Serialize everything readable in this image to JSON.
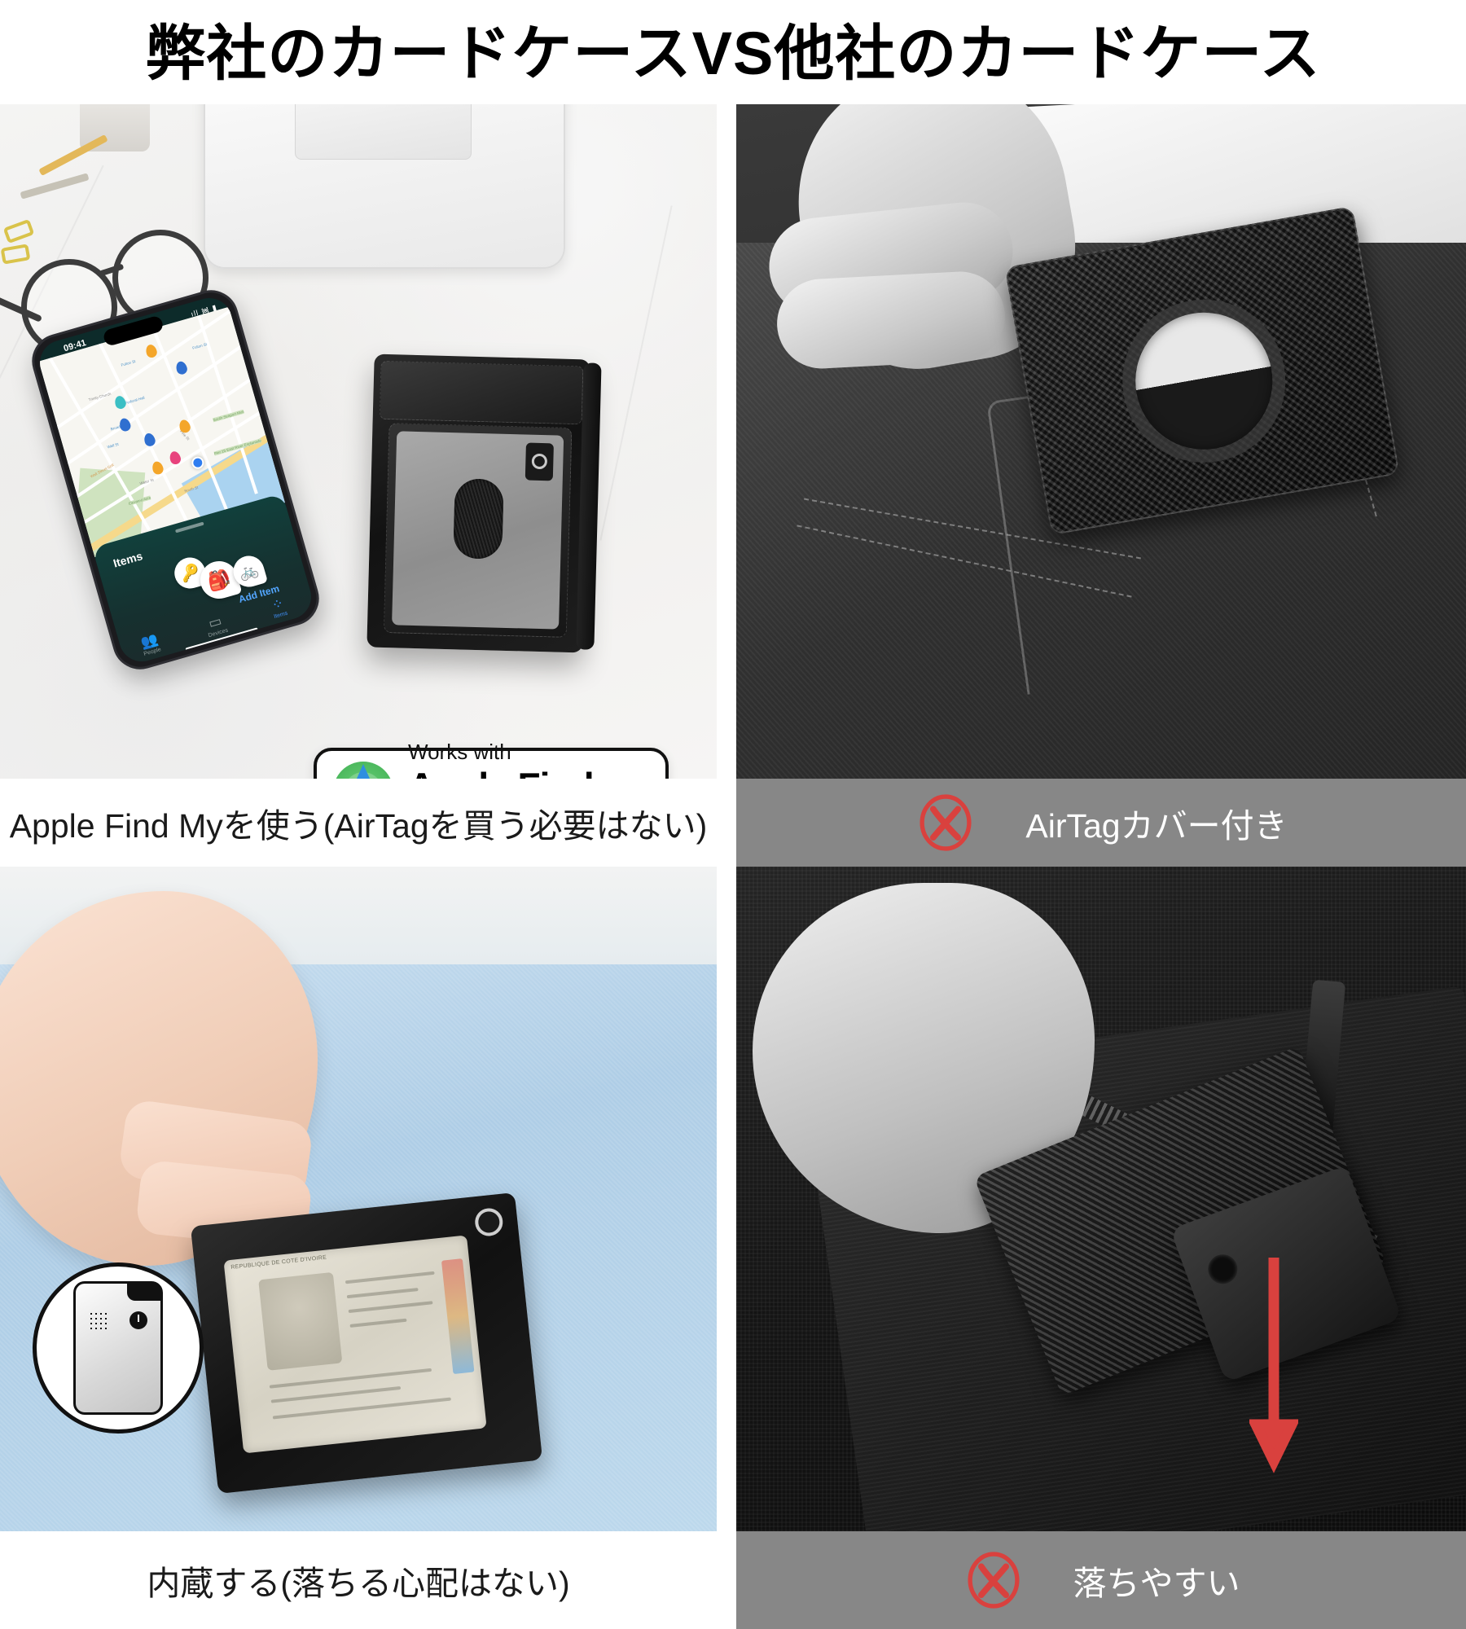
{
  "title": "弊社のカードケースVS他社のカードケース",
  "panels": {
    "top_left": {
      "caption": "Apple Find Myを使う(AirTagを買う必要はない)",
      "badge": {
        "small_text": "Works with",
        "big_text": "Apple Find My",
        "icon": "find-my-radar-icon"
      },
      "phone": {
        "status_time": "09:41",
        "status_right": "ıll ᯼ ▮",
        "sheet_title": "Items",
        "add_item_label": "Add Item",
        "item_bubbles": [
          "🔑",
          "🎒",
          "🚲"
        ],
        "tabs": [
          {
            "label": "People",
            "icon": "people-icon",
            "glyph": "👥",
            "active": false
          },
          {
            "label": "Devices",
            "icon": "devices-icon",
            "glyph": "▭",
            "active": false
          },
          {
            "label": "Items",
            "icon": "items-icon",
            "glyph": "⁘",
            "active": true
          }
        ],
        "map_labels": [
          {
            "text": "Fulton St",
            "color": "blue"
          },
          {
            "text": "Fulton St",
            "color": "blue"
          },
          {
            "text": "Federal Hall",
            "color": "blue"
          },
          {
            "text": "Broad St",
            "color": "blue"
          },
          {
            "text": "Wall St",
            "color": "blue"
          },
          {
            "text": "Trinity Church",
            "color": "gray"
          },
          {
            "text": "Wall Street Grill",
            "color": "orange"
          },
          {
            "text": "Water St",
            "color": "gray"
          },
          {
            "text": "South St",
            "color": "gray"
          },
          {
            "text": "Pine St",
            "color": "gray"
          },
          {
            "text": "Elevated Acre",
            "color": "green"
          },
          {
            "text": "South Seaport Mus",
            "color": "green"
          },
          {
            "text": "Pier 15 East River Esplanade",
            "color": "green"
          },
          {
            "text": "Front St",
            "color": "gray"
          },
          {
            "text": "Liberty St",
            "color": "gray"
          }
        ]
      }
    },
    "top_right": {
      "caption": "AirTagカバー付き",
      "mark": "red-x-mark",
      "mark_color": "#D9413E"
    },
    "bottom_left": {
      "caption": "内蔵する(落ちる心配はない)",
      "badge_icon": "built-in-tracker-icon",
      "id_card_header": "REPUBLIQUE DE COTE D'IVOIRE"
    },
    "bottom_right": {
      "caption": "落ちやすい",
      "mark": "red-x-mark",
      "mark_color": "#D9413E",
      "arrow": "red-down-arrow"
    }
  },
  "colors": {
    "caption_bar": "#878787",
    "caption_text_light": "#ffffff",
    "caption_text_dark": "#1a1a1a",
    "accent_red": "#D9413E",
    "background": "#ffffff"
  }
}
